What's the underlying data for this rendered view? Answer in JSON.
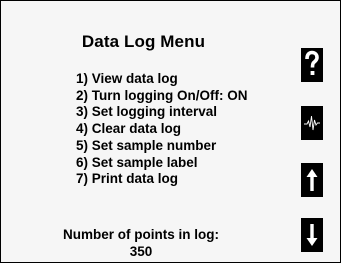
{
  "title": "Data Log Menu",
  "menu_items": [
    "1) View data log",
    "2) Turn logging On/Off: ON",
    "3) Set logging interval",
    "4) Clear data log",
    "5) Set sample number",
    "6) Set sample label",
    "7) Print data log"
  ],
  "points_label": "Number of points in log:",
  "points_value": "350",
  "side_buttons": [
    {
      "icon": "question-mark-icon"
    },
    {
      "icon": "waveform-icon"
    },
    {
      "icon": "arrow-up-icon"
    },
    {
      "icon": "arrow-down-icon"
    }
  ]
}
